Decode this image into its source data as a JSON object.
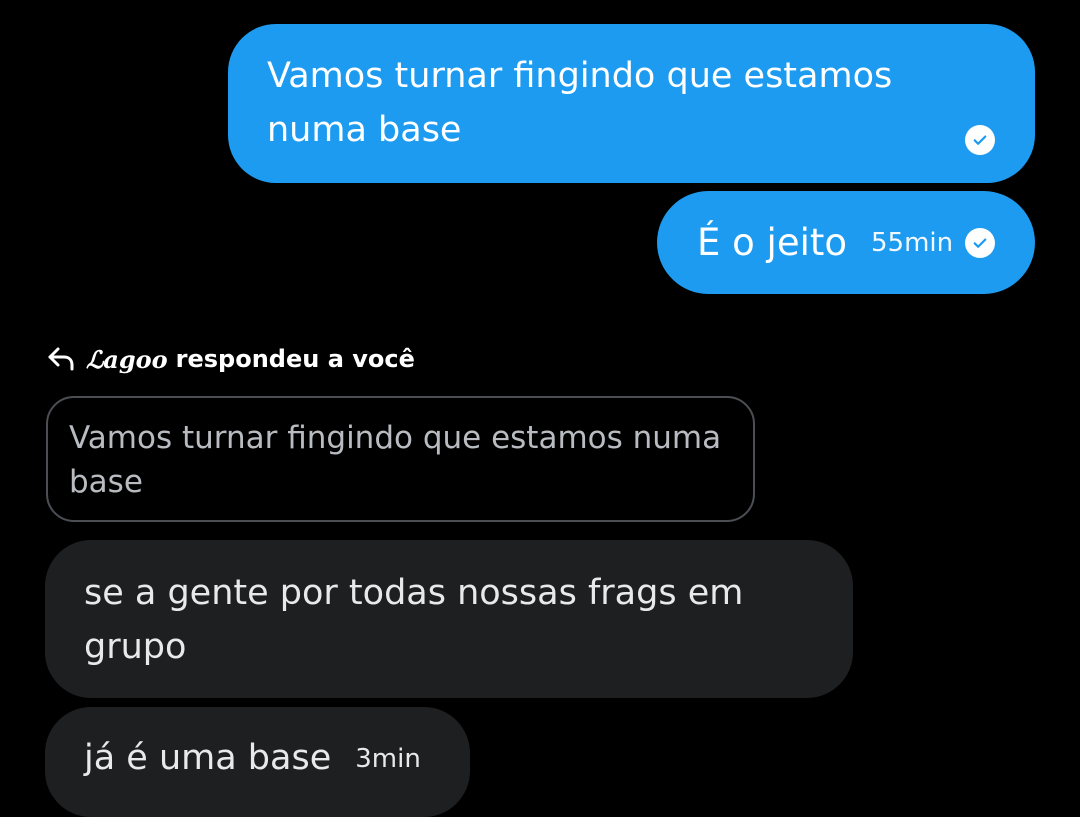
{
  "messages": [
    {
      "id": "msg1",
      "direction": "sent",
      "text": "Vamos turnar fingindo que estamos numa base",
      "status_icon": "read-check-icon"
    },
    {
      "id": "msg2",
      "direction": "sent",
      "text": "É o jeito",
      "time": "55min",
      "status_icon": "read-check-icon"
    }
  ],
  "reply_context": {
    "icon": "reply-arrow-icon",
    "username": "ℒagoo",
    "action_text": "respondeu a você",
    "quoted_text": "Vamos turnar fingindo que estamos numa base"
  },
  "received": [
    {
      "id": "msg3",
      "direction": "received",
      "text": "se a gente por todas nossas frags em grupo"
    },
    {
      "id": "msg4",
      "direction": "received",
      "text": "já é uma base",
      "time": "3min"
    }
  ],
  "colors": {
    "background": "#000000",
    "sent_bubble": "#1d9bf0",
    "received_bubble": "#1e1f21",
    "quote_border": "#4b4f54"
  }
}
